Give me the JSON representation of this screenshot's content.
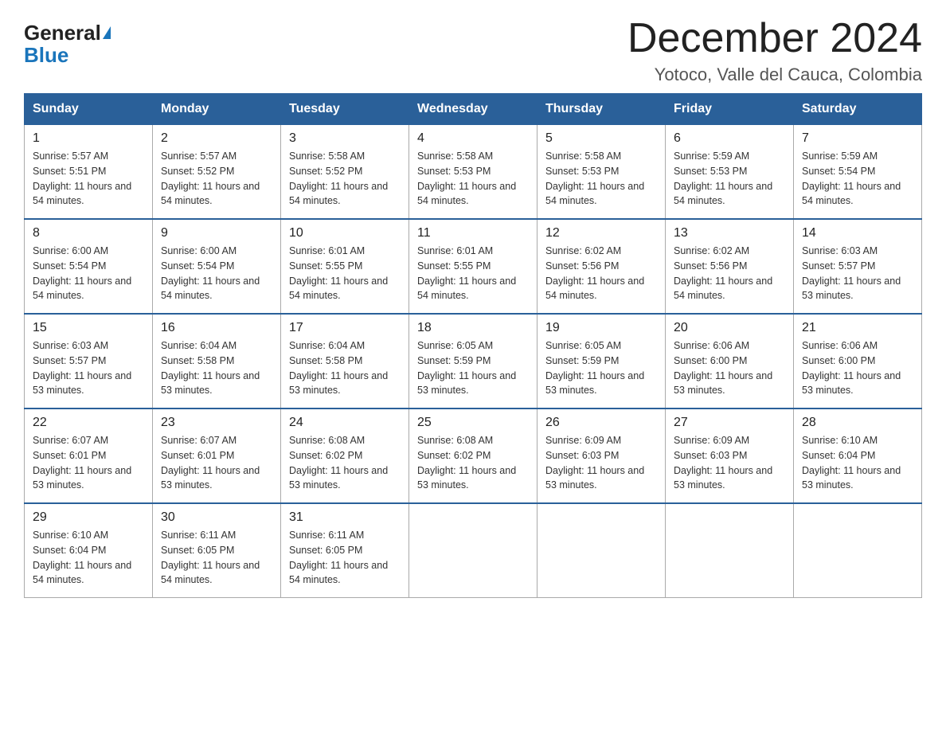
{
  "logo": {
    "general": "General",
    "blue": "Blue"
  },
  "title": "December 2024",
  "subtitle": "Yotoco, Valle del Cauca, Colombia",
  "days_of_week": [
    "Sunday",
    "Monday",
    "Tuesday",
    "Wednesday",
    "Thursday",
    "Friday",
    "Saturday"
  ],
  "weeks": [
    [
      {
        "day": "1",
        "sunrise": "5:57 AM",
        "sunset": "5:51 PM",
        "daylight": "11 hours and 54 minutes."
      },
      {
        "day": "2",
        "sunrise": "5:57 AM",
        "sunset": "5:52 PM",
        "daylight": "11 hours and 54 minutes."
      },
      {
        "day": "3",
        "sunrise": "5:58 AM",
        "sunset": "5:52 PM",
        "daylight": "11 hours and 54 minutes."
      },
      {
        "day": "4",
        "sunrise": "5:58 AM",
        "sunset": "5:53 PM",
        "daylight": "11 hours and 54 minutes."
      },
      {
        "day": "5",
        "sunrise": "5:58 AM",
        "sunset": "5:53 PM",
        "daylight": "11 hours and 54 minutes."
      },
      {
        "day": "6",
        "sunrise": "5:59 AM",
        "sunset": "5:53 PM",
        "daylight": "11 hours and 54 minutes."
      },
      {
        "day": "7",
        "sunrise": "5:59 AM",
        "sunset": "5:54 PM",
        "daylight": "11 hours and 54 minutes."
      }
    ],
    [
      {
        "day": "8",
        "sunrise": "6:00 AM",
        "sunset": "5:54 PM",
        "daylight": "11 hours and 54 minutes."
      },
      {
        "day": "9",
        "sunrise": "6:00 AM",
        "sunset": "5:54 PM",
        "daylight": "11 hours and 54 minutes."
      },
      {
        "day": "10",
        "sunrise": "6:01 AM",
        "sunset": "5:55 PM",
        "daylight": "11 hours and 54 minutes."
      },
      {
        "day": "11",
        "sunrise": "6:01 AM",
        "sunset": "5:55 PM",
        "daylight": "11 hours and 54 minutes."
      },
      {
        "day": "12",
        "sunrise": "6:02 AM",
        "sunset": "5:56 PM",
        "daylight": "11 hours and 54 minutes."
      },
      {
        "day": "13",
        "sunrise": "6:02 AM",
        "sunset": "5:56 PM",
        "daylight": "11 hours and 54 minutes."
      },
      {
        "day": "14",
        "sunrise": "6:03 AM",
        "sunset": "5:57 PM",
        "daylight": "11 hours and 53 minutes."
      }
    ],
    [
      {
        "day": "15",
        "sunrise": "6:03 AM",
        "sunset": "5:57 PM",
        "daylight": "11 hours and 53 minutes."
      },
      {
        "day": "16",
        "sunrise": "6:04 AM",
        "sunset": "5:58 PM",
        "daylight": "11 hours and 53 minutes."
      },
      {
        "day": "17",
        "sunrise": "6:04 AM",
        "sunset": "5:58 PM",
        "daylight": "11 hours and 53 minutes."
      },
      {
        "day": "18",
        "sunrise": "6:05 AM",
        "sunset": "5:59 PM",
        "daylight": "11 hours and 53 minutes."
      },
      {
        "day": "19",
        "sunrise": "6:05 AM",
        "sunset": "5:59 PM",
        "daylight": "11 hours and 53 minutes."
      },
      {
        "day": "20",
        "sunrise": "6:06 AM",
        "sunset": "6:00 PM",
        "daylight": "11 hours and 53 minutes."
      },
      {
        "day": "21",
        "sunrise": "6:06 AM",
        "sunset": "6:00 PM",
        "daylight": "11 hours and 53 minutes."
      }
    ],
    [
      {
        "day": "22",
        "sunrise": "6:07 AM",
        "sunset": "6:01 PM",
        "daylight": "11 hours and 53 minutes."
      },
      {
        "day": "23",
        "sunrise": "6:07 AM",
        "sunset": "6:01 PM",
        "daylight": "11 hours and 53 minutes."
      },
      {
        "day": "24",
        "sunrise": "6:08 AM",
        "sunset": "6:02 PM",
        "daylight": "11 hours and 53 minutes."
      },
      {
        "day": "25",
        "sunrise": "6:08 AM",
        "sunset": "6:02 PM",
        "daylight": "11 hours and 53 minutes."
      },
      {
        "day": "26",
        "sunrise": "6:09 AM",
        "sunset": "6:03 PM",
        "daylight": "11 hours and 53 minutes."
      },
      {
        "day": "27",
        "sunrise": "6:09 AM",
        "sunset": "6:03 PM",
        "daylight": "11 hours and 53 minutes."
      },
      {
        "day": "28",
        "sunrise": "6:10 AM",
        "sunset": "6:04 PM",
        "daylight": "11 hours and 53 minutes."
      }
    ],
    [
      {
        "day": "29",
        "sunrise": "6:10 AM",
        "sunset": "6:04 PM",
        "daylight": "11 hours and 54 minutes."
      },
      {
        "day": "30",
        "sunrise": "6:11 AM",
        "sunset": "6:05 PM",
        "daylight": "11 hours and 54 minutes."
      },
      {
        "day": "31",
        "sunrise": "6:11 AM",
        "sunset": "6:05 PM",
        "daylight": "11 hours and 54 minutes."
      },
      null,
      null,
      null,
      null
    ]
  ]
}
